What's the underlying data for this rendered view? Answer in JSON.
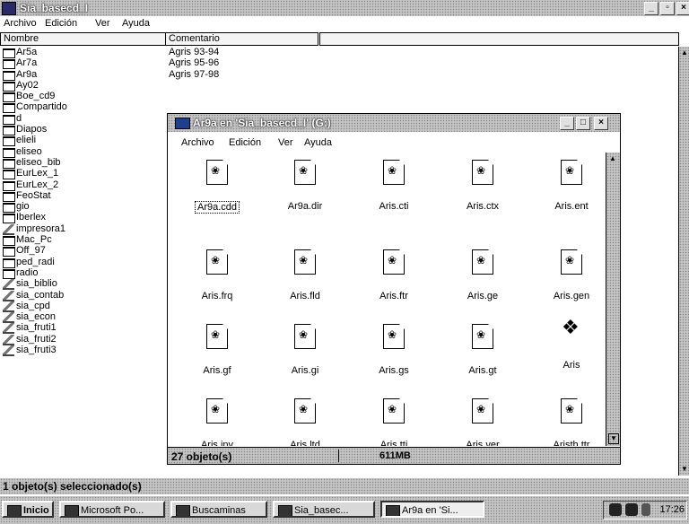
{
  "main_window": {
    "title": "Sia_basecd_I",
    "controls": {
      "minimize": "_",
      "maximize": "▫",
      "close": "×"
    },
    "menu": [
      "Archivo",
      "Edición",
      "Ver",
      "Ayuda"
    ],
    "columns": {
      "name": "Nombre",
      "comment": "Comentario"
    },
    "folders": [
      {
        "name": "Ar5a",
        "type": "folder"
      },
      {
        "name": "Ar7a",
        "type": "folder"
      },
      {
        "name": "Ar9a",
        "type": "folder"
      },
      {
        "name": "Ay02",
        "type": "folder"
      },
      {
        "name": "Boe_cd9",
        "type": "folder"
      },
      {
        "name": "Compartido",
        "type": "folder"
      },
      {
        "name": "d",
        "type": "folder"
      },
      {
        "name": "Diapos",
        "type": "folder"
      },
      {
        "name": "elieli",
        "type": "folder"
      },
      {
        "name": "eliseo",
        "type": "folder"
      },
      {
        "name": "eliseo_bib",
        "type": "folder"
      },
      {
        "name": "EurLex_1",
        "type": "folder"
      },
      {
        "name": "EurLex_2",
        "type": "folder"
      },
      {
        "name": "FeoStat",
        "type": "folder"
      },
      {
        "name": "gio",
        "type": "folder"
      },
      {
        "name": "Iberlex",
        "type": "folder"
      },
      {
        "name": "impresora1",
        "type": "network"
      },
      {
        "name": "Mac_Pc",
        "type": "folder"
      },
      {
        "name": "Off_97",
        "type": "folder"
      },
      {
        "name": "ped_radi",
        "type": "folder"
      },
      {
        "name": "radio",
        "type": "folder"
      },
      {
        "name": "sia_biblio",
        "type": "network"
      },
      {
        "name": "sia_contab",
        "type": "network"
      },
      {
        "name": "sia_cpd",
        "type": "network"
      },
      {
        "name": "sia_econ",
        "type": "network"
      },
      {
        "name": "sia_fruti1",
        "type": "network"
      },
      {
        "name": "sia_fruti2",
        "type": "network"
      },
      {
        "name": "sia_fruti3",
        "type": "network"
      }
    ],
    "comments": [
      "Agris 93-94",
      "Agris 95-96",
      "Agris 97-98"
    ],
    "status": "1 objeto(s) seleccionado(s)"
  },
  "child_window": {
    "title": "Ar9a en 'Sia_basecd_I' (G:)",
    "controls": {
      "minimize": "_",
      "maximize": "□",
      "close": "×"
    },
    "menu": [
      "Archivo",
      "Edición",
      "Ver",
      "Ayuda"
    ],
    "files": [
      {
        "name": "Ar9a.cdd",
        "selected": true,
        "icon": "file-icon"
      },
      {
        "name": "Ar9a.dir",
        "icon": "file-icon"
      },
      {
        "name": "Aris.cti",
        "icon": "file-icon"
      },
      {
        "name": "Aris.ctx",
        "icon": "file-icon"
      },
      {
        "name": "Aris.ent",
        "icon": "file-icon"
      },
      {
        "name": "Aris.frq",
        "icon": "file-icon"
      },
      {
        "name": "Aris.fld",
        "icon": "file-icon"
      },
      {
        "name": "Aris.ftr",
        "icon": "file-icon"
      },
      {
        "name": "Aris.ge",
        "icon": "file-icon"
      },
      {
        "name": "Aris.gen",
        "icon": "file-icon"
      },
      {
        "name": "Aris.gf",
        "icon": "file-icon"
      },
      {
        "name": "Aris.gi",
        "icon": "file-icon"
      },
      {
        "name": "Aris.gs",
        "icon": "file-icon"
      },
      {
        "name": "Aris.gt",
        "icon": "file-icon"
      },
      {
        "name": "Aris",
        "icon": "book-icon"
      },
      {
        "name": "Aris.inv",
        "icon": "file-icon"
      },
      {
        "name": "Aris.ltd",
        "icon": "file-icon"
      },
      {
        "name": "Aris.tti",
        "icon": "file-icon"
      },
      {
        "name": "Aris.ver",
        "icon": "file-icon"
      },
      {
        "name": "Aristh.ttr",
        "icon": "file-icon"
      }
    ],
    "status_count": "27 objeto(s)",
    "status_size": "611MB"
  },
  "taskbar": {
    "start": "Inicio",
    "buttons": [
      "Microsoft Po...",
      "Buscaminas",
      "Sia_basec...",
      "Ar9a en 'Si..."
    ],
    "clock": "17:26"
  }
}
